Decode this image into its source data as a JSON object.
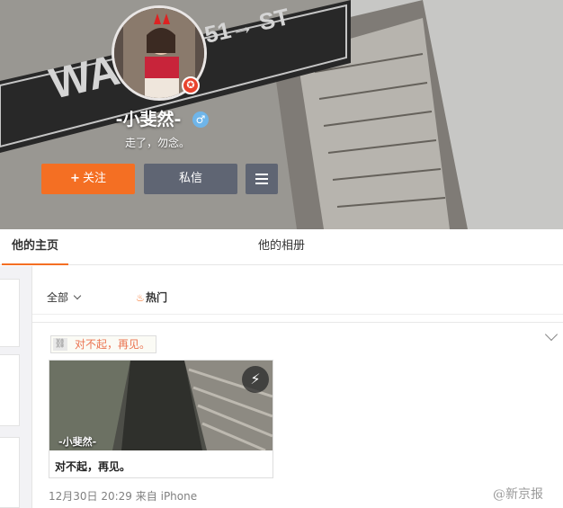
{
  "profile": {
    "name": "-小斐然-",
    "bio": "走了，勿念。",
    "vip_badge": "✪",
    "gender_symbol": "♂",
    "gender_icon": "male-icon",
    "follow_plus": "+",
    "follow_label": "关注",
    "message_label": "私信",
    "more_icon": "menu-icon",
    "cover_sign_top": "51→ ST",
    "cover_sign_main": "WALL"
  },
  "tabs": {
    "home": "他的主页",
    "album": "他的相册"
  },
  "filter": {
    "all_label": "全部",
    "hot_label": "热门"
  },
  "post": {
    "tag_text": "对不起，再见。",
    "tag_icon": "link-icon",
    "media_label": "-小斐然-",
    "media_badge": "⚡",
    "media_caption": "对不起，再见。",
    "date": "12月30日 20:29",
    "source_prefix": "来自",
    "source": "iPhone"
  },
  "watermark": "@新京报",
  "colors": {
    "accent": "#f46f23",
    "button_dark": "#5f6573",
    "link_orange": "#eb7350"
  }
}
